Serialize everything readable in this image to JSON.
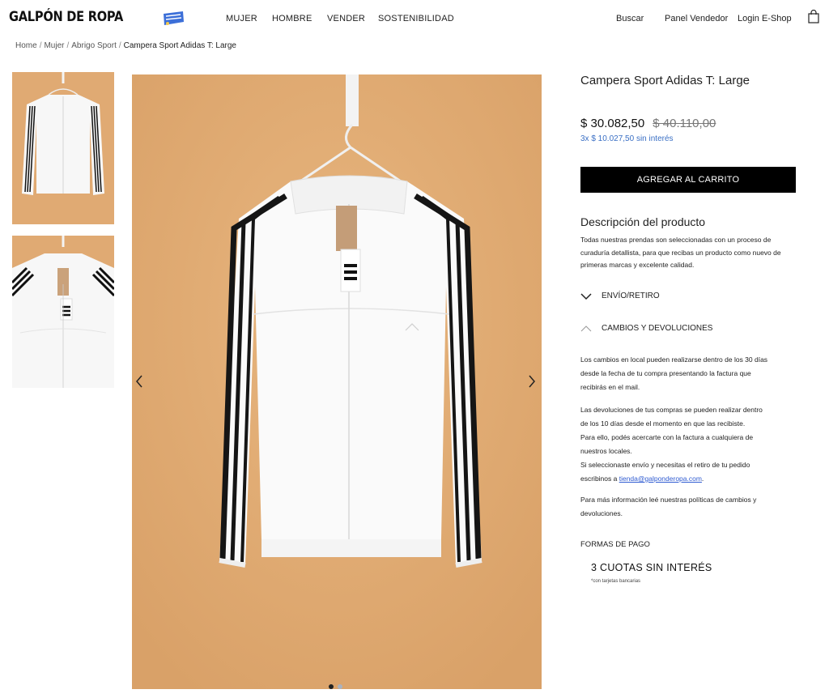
{
  "header": {
    "logo": "GALPÓN DE ROPA",
    "nav": [
      "MUJER",
      "HOMBRE",
      "VENDER",
      "SOSTENIBILIDAD"
    ],
    "links": [
      "Buscar",
      "Panel Vendedor",
      "Login E-Shop"
    ]
  },
  "breadcrumb": [
    "Home",
    "Mujer",
    "Abrigo Sport",
    "Campera Sport Adidas T: Large"
  ],
  "product": {
    "title": "Campera Sport Adidas T: Large",
    "price": "$ 30.082,50",
    "old_price": "$ 40.110,00",
    "installments": "3x $ 10.027,50 sin interés",
    "cart_button": "AGREGAR AL CARRITO",
    "desc_title": "Descripción del producto",
    "desc_lines": [
      "Todas nuestras prendas son seleccionadas con un proceso de",
      "curaduría detallista, para que recibas un producto como nuevo de",
      "primeras marcas y excelente calidad."
    ],
    "accordion": {
      "shipping": "ENVÍO/RETIRO",
      "returns": "CAMBIOS Y DEVOLUCIONES"
    },
    "policy_p1": [
      "Los cambios en local pueden realizarse dentro de los 30 días",
      "desde la fecha de tu compra presentando la factura que",
      "recibirás en el mail."
    ],
    "policy_p2": [
      "Las devoluciones de tus compras se pueden realizar dentro",
      "de los 10 días desde el momento en que las recibiste.",
      "Para ello, podés acercarte con la factura a cualquiera de",
      "nuestros locales.",
      "Si seleccionaste envío y necesitas el retiro de tu pedido"
    ],
    "policy_p2_last_prefix": "escribinos a ",
    "policy_email": "tienda@galponderopa.com",
    "policy_p2_last_suffix": ".",
    "policy_p3": [
      "Para más información leé nuestras políticas de cambios y",
      "devoluciones."
    ],
    "payment_label": "FORMAS DE PAGO",
    "payment_title": "3 CUOTAS SIN INTERÉS",
    "payment_note": "*con tarjetas bancarias"
  },
  "gallery": {
    "prev_icon": "chevron-left-icon",
    "next_icon": "chevron-right-icon",
    "active_dot": 0,
    "dot_count": 2
  },
  "colors": {
    "background_photo": "#e2ad75",
    "link_blue": "#3a6fc4",
    "button_black": "#000000"
  }
}
